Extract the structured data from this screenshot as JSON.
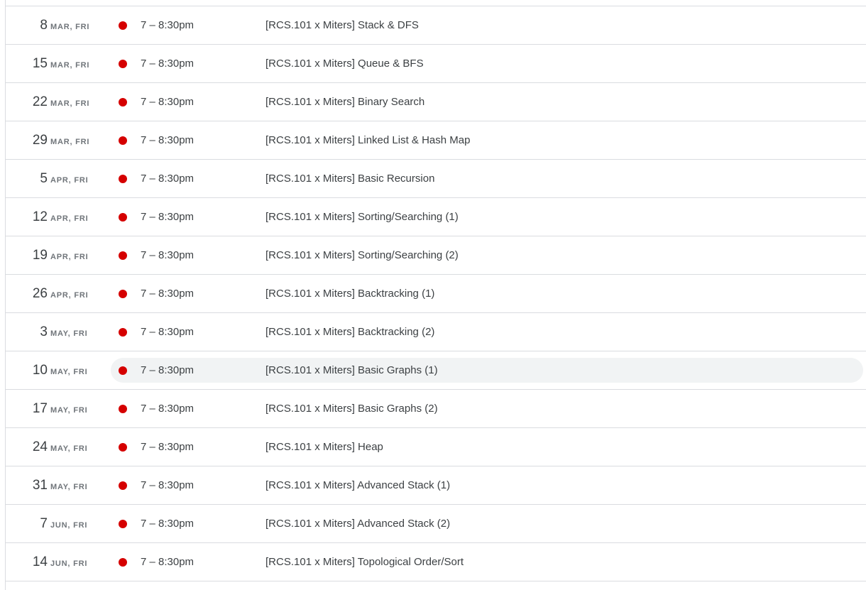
{
  "colors": {
    "event_dot": "#d50000",
    "divider": "#dadce0",
    "hover_bg": "#f1f3f4"
  },
  "icons": {
    "event_marker": "filled-circle"
  },
  "events": [
    {
      "day": "8",
      "meta": "MAR, FRI",
      "time": "7 – 8:30pm",
      "title": "[RCS.101 x Miters] Stack & DFS"
    },
    {
      "day": "15",
      "meta": "MAR, FRI",
      "time": "7 – 8:30pm",
      "title": "[RCS.101 x Miters] Queue & BFS"
    },
    {
      "day": "22",
      "meta": "MAR, FRI",
      "time": "7 – 8:30pm",
      "title": "[RCS.101 x Miters] Binary Search"
    },
    {
      "day": "29",
      "meta": "MAR, FRI",
      "time": "7 – 8:30pm",
      "title": "[RCS.101 x Miters] Linked List & Hash Map"
    },
    {
      "day": "5",
      "meta": "APR, FRI",
      "time": "7 – 8:30pm",
      "title": "[RCS.101 x Miters] Basic Recursion"
    },
    {
      "day": "12",
      "meta": "APR, FRI",
      "time": "7 – 8:30pm",
      "title": "[RCS.101 x Miters] Sorting/Searching (1)"
    },
    {
      "day": "19",
      "meta": "APR, FRI",
      "time": "7 – 8:30pm",
      "title": "[RCS.101 x Miters] Sorting/Searching (2)"
    },
    {
      "day": "26",
      "meta": "APR, FRI",
      "time": "7 – 8:30pm",
      "title": "[RCS.101 x Miters] Backtracking (1)"
    },
    {
      "day": "3",
      "meta": "MAY, FRI",
      "time": "7 – 8:30pm",
      "title": "[RCS.101 x Miters] Backtracking (2)"
    },
    {
      "day": "10",
      "meta": "MAY, FRI",
      "time": "7 – 8:30pm",
      "title": "[RCS.101 x Miters] Basic Graphs (1)",
      "hovered": true
    },
    {
      "day": "17",
      "meta": "MAY, FRI",
      "time": "7 – 8:30pm",
      "title": "[RCS.101 x Miters] Basic Graphs (2)"
    },
    {
      "day": "24",
      "meta": "MAY, FRI",
      "time": "7 – 8:30pm",
      "title": "[RCS.101 x Miters] Heap"
    },
    {
      "day": "31",
      "meta": "MAY, FRI",
      "time": "7 – 8:30pm",
      "title": "[RCS.101 x Miters] Advanced Stack (1)"
    },
    {
      "day": "7",
      "meta": "JUN, FRI",
      "time": "7 – 8:30pm",
      "title": "[RCS.101 x Miters] Advanced Stack (2)"
    },
    {
      "day": "14",
      "meta": "JUN, FRI",
      "time": "7 – 8:30pm",
      "title": "[RCS.101 x Miters] Topological Order/Sort"
    }
  ]
}
